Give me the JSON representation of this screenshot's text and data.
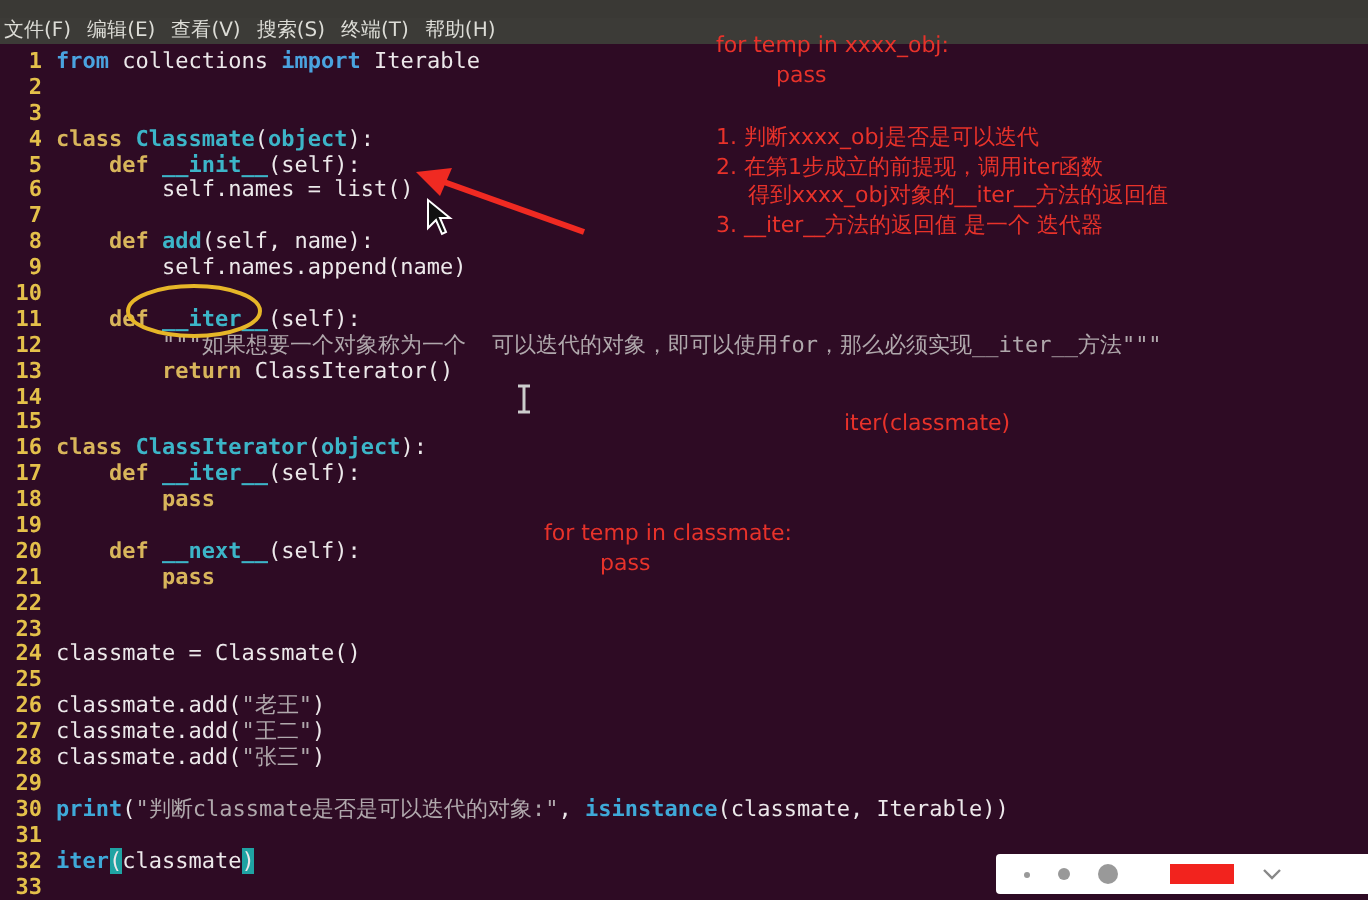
{
  "menu": [
    {
      "label": "文件(F)"
    },
    {
      "label": "编辑(E)"
    },
    {
      "label": "查看(V)"
    },
    {
      "label": "搜索(S)"
    },
    {
      "label": "终端(T)"
    },
    {
      "label": "帮助(H)"
    }
  ],
  "code": [
    {
      "n": "1",
      "tokens": [
        {
          "kind": "import",
          "text": "from"
        },
        {
          "kind": "plain",
          "text": " collections "
        },
        {
          "kind": "import",
          "text": "import"
        },
        {
          "kind": "plain",
          "text": " Iterable"
        }
      ]
    },
    {
      "n": "2"
    },
    {
      "n": "3"
    },
    {
      "n": "4",
      "tokens": [
        {
          "kind": "keyword",
          "text": "class "
        },
        {
          "kind": "name",
          "text": "Classmate"
        },
        {
          "kind": "plain",
          "text": "("
        },
        {
          "kind": "name",
          "text": "object"
        },
        {
          "kind": "plain",
          "text": "):"
        }
      ]
    },
    {
      "n": "5",
      "tokens": [
        {
          "kind": "keyword",
          "text": "    def "
        },
        {
          "kind": "name",
          "text": "__init__"
        },
        {
          "kind": "plain",
          "text": "(self):"
        }
      ]
    },
    {
      "n": "6",
      "tokens": [
        {
          "kind": "plain",
          "text": "        self.names = list()"
        }
      ]
    },
    {
      "n": "7"
    },
    {
      "n": "8",
      "tokens": [
        {
          "kind": "keyword",
          "text": "    def "
        },
        {
          "kind": "name",
          "text": "add"
        },
        {
          "kind": "plain",
          "text": "(self, name):"
        }
      ]
    },
    {
      "n": "9",
      "tokens": [
        {
          "kind": "plain",
          "text": "        self.names.append(name)"
        }
      ]
    },
    {
      "n": "10"
    },
    {
      "n": "11",
      "tokens": [
        {
          "kind": "keyword",
          "text": "    def "
        },
        {
          "kind": "name",
          "text": "__iter__"
        },
        {
          "kind": "plain",
          "text": "(self):"
        }
      ]
    },
    {
      "n": "12",
      "tokens": [
        {
          "kind": "string",
          "text": "        \"\"\"如果想要一个对象称为一个  可以迭代的对象，即可以使用for，那么必须实现__iter__方法\"\"\""
        }
      ]
    },
    {
      "n": "13",
      "tokens": [
        {
          "kind": "keyword",
          "text": "        return"
        },
        {
          "kind": "plain",
          "text": " ClassIterator()"
        }
      ]
    },
    {
      "n": "14"
    },
    {
      "n": "15"
    },
    {
      "n": "16",
      "tokens": [
        {
          "kind": "keyword",
          "text": "class "
        },
        {
          "kind": "name",
          "text": "ClassIterator"
        },
        {
          "kind": "plain",
          "text": "("
        },
        {
          "kind": "name",
          "text": "object"
        },
        {
          "kind": "plain",
          "text": "):"
        }
      ]
    },
    {
      "n": "17",
      "tokens": [
        {
          "kind": "keyword",
          "text": "    def "
        },
        {
          "kind": "name",
          "text": "__iter__"
        },
        {
          "kind": "plain",
          "text": "(self):"
        }
      ]
    },
    {
      "n": "18",
      "tokens": [
        {
          "kind": "keyword",
          "text": "        pass"
        }
      ]
    },
    {
      "n": "19"
    },
    {
      "n": "20",
      "tokens": [
        {
          "kind": "keyword",
          "text": "    def "
        },
        {
          "kind": "name",
          "text": "__next__"
        },
        {
          "kind": "plain",
          "text": "(self):"
        }
      ]
    },
    {
      "n": "21",
      "tokens": [
        {
          "kind": "keyword",
          "text": "        pass"
        }
      ]
    },
    {
      "n": "22"
    },
    {
      "n": "23"
    },
    {
      "n": "24",
      "tokens": [
        {
          "kind": "plain",
          "text": "classmate = Classmate()"
        }
      ]
    },
    {
      "n": "25"
    },
    {
      "n": "26",
      "tokens": [
        {
          "kind": "plain",
          "text": "classmate.add("
        },
        {
          "kind": "string",
          "text": "\"老王\""
        },
        {
          "kind": "plain",
          "text": ")"
        }
      ]
    },
    {
      "n": "27",
      "tokens": [
        {
          "kind": "plain",
          "text": "classmate.add("
        },
        {
          "kind": "string",
          "text": "\"王二\""
        },
        {
          "kind": "plain",
          "text": ")"
        }
      ]
    },
    {
      "n": "28",
      "tokens": [
        {
          "kind": "plain",
          "text": "classmate.add("
        },
        {
          "kind": "string",
          "text": "\"张三\""
        },
        {
          "kind": "plain",
          "text": ")"
        }
      ]
    },
    {
      "n": "29"
    },
    {
      "n": "30",
      "tokens": [
        {
          "kind": "builtin",
          "text": "print"
        },
        {
          "kind": "plain",
          "text": "("
        },
        {
          "kind": "string",
          "text": "\"判断classmate是否是可以迭代的对象:\""
        },
        {
          "kind": "plain",
          "text": ", "
        },
        {
          "kind": "builtin",
          "text": "isinstance"
        },
        {
          "kind": "plain",
          "text": "(classmate, Iterable))"
        }
      ]
    },
    {
      "n": "31"
    },
    {
      "n": "32",
      "tokens": [
        {
          "kind": "builtin",
          "text": "iter"
        },
        {
          "kind": "match",
          "text": "("
        },
        {
          "kind": "plain",
          "text": "classmate"
        },
        {
          "kind": "match",
          "text": ")"
        }
      ]
    },
    {
      "n": "33"
    }
  ],
  "notes": [
    {
      "lines": [
        "for temp in xxxx_obj:",
        "pass"
      ]
    },
    {
      "lines": [
        "1. 判断xxxx_obj是否是可以迭代",
        "2. 在第1步成立的前提现，调用iter函数",
        "得到xxxx_obj对象的__iter__方法的返回值",
        "3. __iter__方法的返回值 是一个 迭代器"
      ]
    },
    {
      "lines": [
        "iter(classmate)"
      ]
    },
    {
      "lines": [
        "for temp in classmate:",
        "pass"
      ]
    }
  ]
}
